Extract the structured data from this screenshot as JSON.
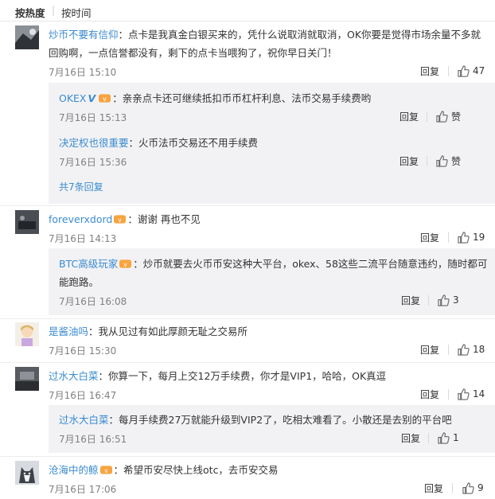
{
  "sort": {
    "hot": "按热度",
    "time": "按时间"
  },
  "labels": {
    "reply": "回复",
    "like": "赞"
  },
  "colors": {
    "link": "#3a8bd0",
    "replyBg": "#f2f2f5"
  },
  "comments": [
    {
      "name": "炒币不要有信仰",
      "text": "：点卡是我真金白银买来的，凭什么说取消就取消，OK你要是觉得市场余量不多就回购啊，一点信誉都没有，剩下的点卡当喂狗了，祝你早日关门！",
      "date": "7月16日 15:10",
      "likes": "47",
      "replies": [
        {
          "name": "OKEX",
          "text": "：亲亲点卡还可继续抵扣币币杠杆利息、法币交易手续费哟",
          "date": "7月16日 15:13",
          "likes": "赞"
        },
        {
          "name": "决定权也很重要",
          "text": "：火币法币交易还不用手续费",
          "date": "7月16日 15:36",
          "likes": "赞"
        }
      ],
      "more": "共7条回复"
    },
    {
      "name": "foreverxdord",
      "text": "：谢谢 再也不见",
      "date": "7月16日 14:13",
      "likes": "19",
      "replies": [
        {
          "name": "BTC高级玩家",
          "text": "：炒币就要去火币币安这种大平台，okex、58这些二流平台随意违约，随时都可能跑路。",
          "date": "7月16日 16:08",
          "likes": "3"
        }
      ]
    },
    {
      "name": "是酱油吗",
      "text": "：我从见过有如此厚颜无耻之交易所",
      "date": "7月16日 15:30",
      "likes": "18"
    },
    {
      "name": "过水大白菜",
      "text": "：你算一下，每月上交12万手续费，你才是VIP1，哈哈，OK真逗",
      "date": "7月16日 16:47",
      "likes": "14",
      "replies": [
        {
          "name": "过水大白菜",
          "text": "：每月手续费27万就能升级到VIP2了，吃相太难看了。小散还是去别的平台吧",
          "date": "7月16日 16:51",
          "likes": "1"
        }
      ]
    },
    {
      "name": "沧海中的鲸",
      "text": "：希望币安尽快上线otc，去币安交易",
      "date": "7月16日 17:06",
      "likes": "9"
    }
  ]
}
